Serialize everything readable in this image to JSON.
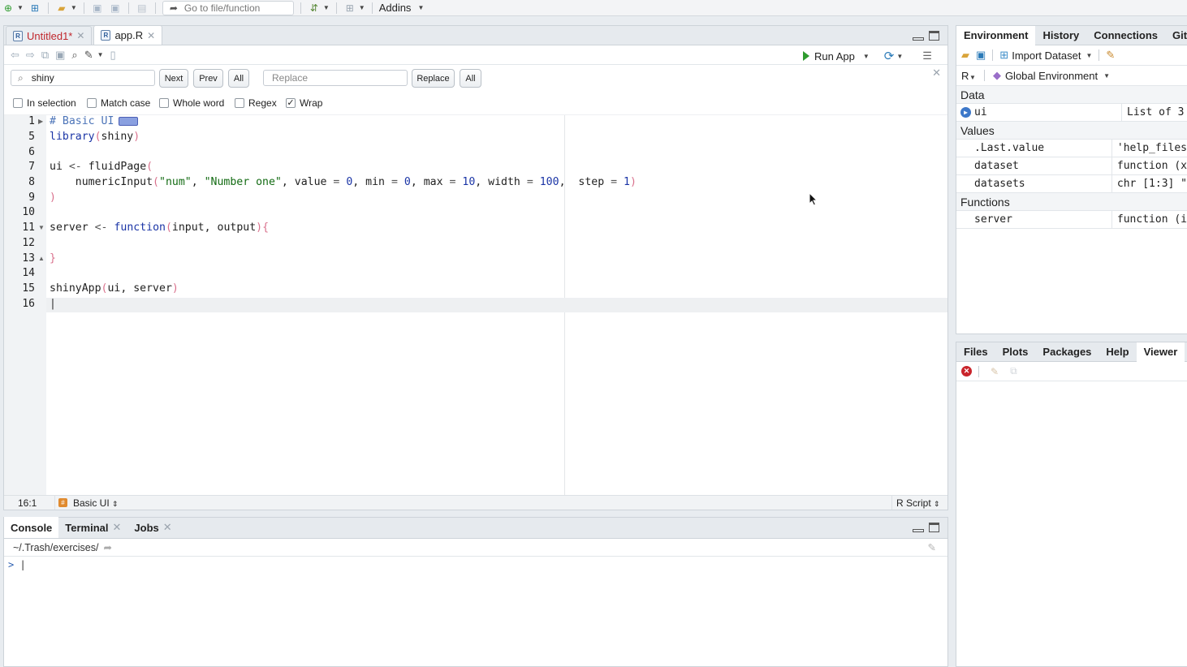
{
  "toolbar": {
    "goto_placeholder": "Go to file/function",
    "addins_label": "Addins"
  },
  "editor": {
    "tabs": [
      {
        "label": "Untitled1*",
        "modified": true
      },
      {
        "label": "app.R",
        "active": true
      }
    ],
    "run_app_label": "Run App",
    "find": {
      "search_value": "shiny",
      "next_label": "Next",
      "prev_label": "Prev",
      "all_label": "All",
      "replace_placeholder": "Replace",
      "replace_label": "Replace",
      "replace_all_label": "All",
      "options": [
        {
          "label": "In selection",
          "checked": false
        },
        {
          "label": "Match case",
          "checked": false
        },
        {
          "label": "Whole word",
          "checked": false
        },
        {
          "label": "Regex",
          "checked": false
        },
        {
          "label": "Wrap",
          "checked": true
        }
      ]
    },
    "line_numbers": [
      "1",
      "5",
      "6",
      "7",
      "8",
      "9",
      "10",
      "11",
      "12",
      "13",
      "14",
      "15",
      "16"
    ],
    "code": {
      "l1": "# Basic UI",
      "l5_fn": "library",
      "l5_arg": "shiny",
      "l7_a": "ui",
      "l7_op": "<-",
      "l7_fn": "fluidPage",
      "l8_fn": "numericInput",
      "l8_s1": "\"num\"",
      "l8_s2": "\"Number one\"",
      "l8_value": "value",
      "l8_eq": "=",
      "l8_v0": "0",
      "l8_min": "min",
      "l8_v1": "0",
      "l8_max": "max",
      "l8_v2": "10",
      "l8_width": "width",
      "l8_v3": "100",
      "l8_step": "step",
      "l8_v4": "1",
      "l11_a": "server",
      "l11_op": "<-",
      "l11_kw": "function",
      "l11_args": "input, output",
      "l15_fn": "shinyApp",
      "l15_args": "ui, server"
    },
    "status": {
      "position": "16:1",
      "section": "Basic UI",
      "file_type": "R Script"
    }
  },
  "console": {
    "tabs": [
      "Console",
      "Terminal",
      "Jobs"
    ],
    "path": "~/.Trash/exercises/",
    "prompt": ">"
  },
  "environment": {
    "tabs": [
      "Environment",
      "History",
      "Connections",
      "Git"
    ],
    "import_label": "Import Dataset",
    "lang_label": "R",
    "scope_label": "Global Environment",
    "sections": {
      "data": "Data",
      "values": "Values",
      "functions": "Functions"
    },
    "data_rows": [
      {
        "name": "ui",
        "value": "List of 3"
      }
    ],
    "value_rows": [
      {
        "name": ".Last.value",
        "value": "'help_files"
      },
      {
        "name": "dataset",
        "value": "function (x"
      },
      {
        "name": "datasets",
        "value": "chr [1:3] \""
      }
    ],
    "function_rows": [
      {
        "name": "server",
        "value": "function (i"
      }
    ]
  },
  "files": {
    "tabs": [
      "Files",
      "Plots",
      "Packages",
      "Help",
      "Viewer"
    ]
  },
  "colors": {
    "accent": "#2e9b2e",
    "modified_tab": "#c0272d",
    "keyword": "#1b35a6",
    "string": "#136b13",
    "comment": "#4c74b8"
  }
}
